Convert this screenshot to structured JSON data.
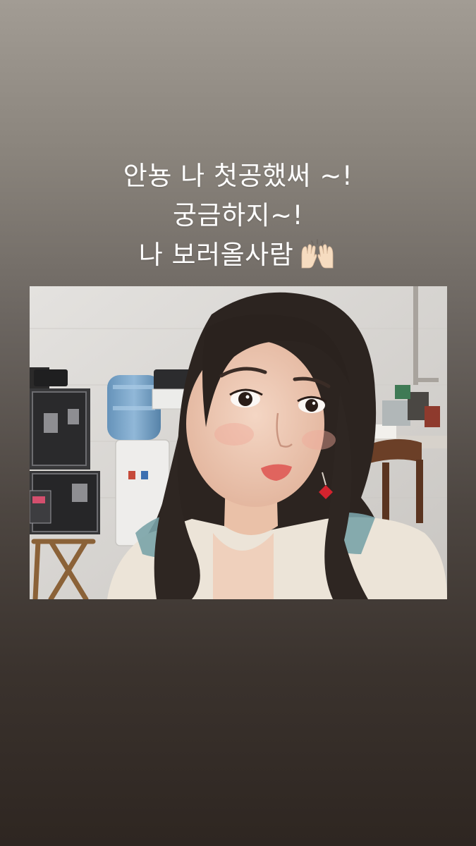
{
  "story": {
    "caption_lines": [
      "안뇽 나 첫공했써 ~!",
      "궁금하지~!",
      "나 보러올사람"
    ],
    "caption_emoji": "raised-hands-emoji",
    "photo_icon": "selfie-photo"
  },
  "colors": {
    "background_top": "#a29c94",
    "background_bottom": "#2e2621",
    "caption_text": "#ffffff"
  }
}
